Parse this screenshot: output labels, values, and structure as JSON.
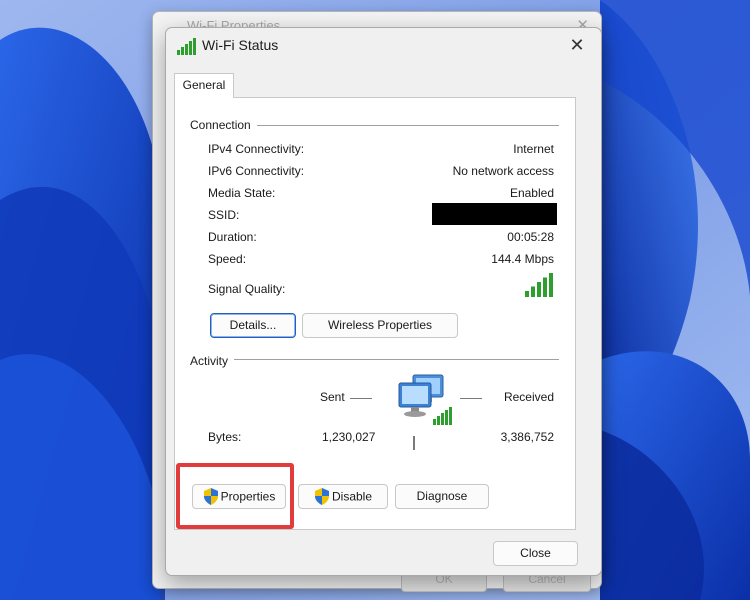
{
  "background_window": {
    "title": "Wi-Fi Properties",
    "close_label": "✕",
    "ok_label": "OK",
    "cancel_label": "Cancel"
  },
  "dialog": {
    "title": "Wi-Fi Status",
    "close_label": "✕",
    "tab_general": "General",
    "connection": {
      "heading": "Connection",
      "rows": [
        {
          "label": "IPv4 Connectivity:",
          "value": "Internet"
        },
        {
          "label": "IPv6 Connectivity:",
          "value": "No network access"
        },
        {
          "label": "Media State:",
          "value": "Enabled"
        },
        {
          "label": "SSID:",
          "value": ""
        },
        {
          "label": "Duration:",
          "value": "00:05:28"
        },
        {
          "label": "Speed:",
          "value": "144.4 Mbps"
        },
        {
          "label": "Signal Quality:",
          "value": ""
        }
      ],
      "signal_bars_filled": 5,
      "signal_bars_total": 5,
      "details_label": "Details...",
      "wireless_properties_label": "Wireless Properties"
    },
    "activity": {
      "heading": "Activity",
      "sent_label": "Sent",
      "received_label": "Received",
      "bytes_label": "Bytes:",
      "sent_bytes": "1,230,027",
      "received_bytes": "3,386,752"
    },
    "buttons": {
      "properties_label": "Properties",
      "disable_label": "Disable",
      "diagnose_label": "Diagnose",
      "close_label": "Close"
    }
  },
  "colors": {
    "accent": "#1f5fbf",
    "highlight": "#e03c3c",
    "signal": "#2e9e2e",
    "wallpaper": "#1746c9"
  },
  "icons": {
    "title": "wifi-signal-icon",
    "network": "network-computers-icon",
    "shield": "uac-shield-icon"
  }
}
